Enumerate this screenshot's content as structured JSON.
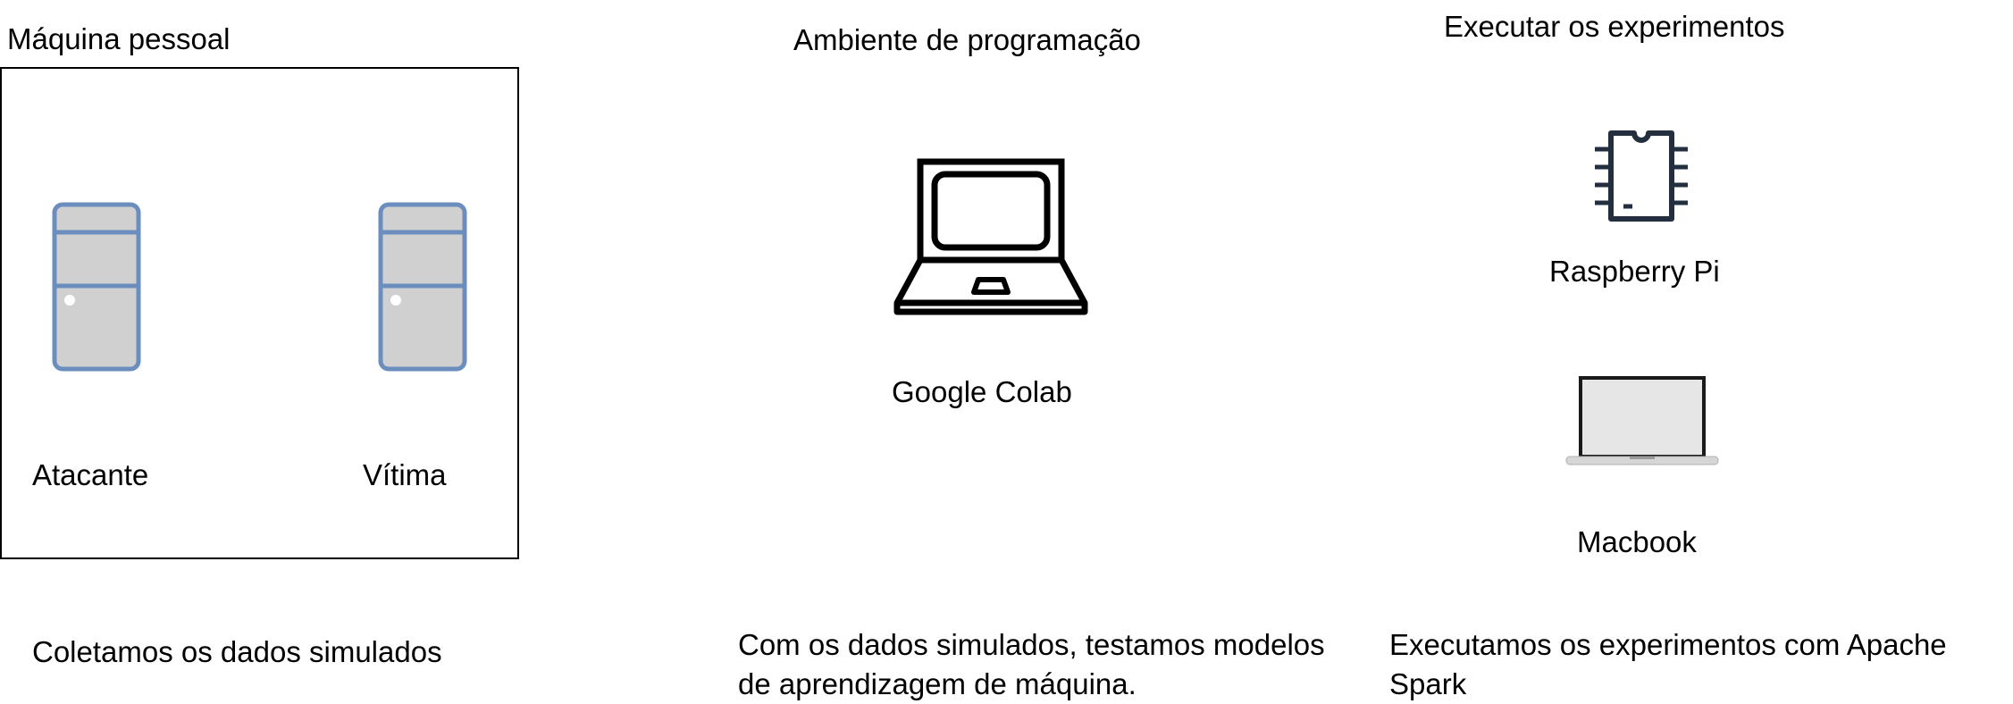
{
  "sections": {
    "personal_machine": {
      "title": "Máquina pessoal",
      "attacker_label": "Atacante",
      "victim_label": "Vítima",
      "caption": "Coletamos os dados simulados"
    },
    "programming_env": {
      "title": "Ambiente de programação",
      "platform_label": "Google Colab",
      "caption": "Com os dados simulados, testamos modelos de aprendizagem de máquina."
    },
    "experiments": {
      "title": "Executar os experimentos",
      "raspberry_label": "Raspberry Pi",
      "macbook_label": "Macbook",
      "caption": "Executamos os experimentos com Apache Spark"
    }
  },
  "colors": {
    "server_stroke": "#6c8ebf",
    "server_fill": "#d0d0d0",
    "chip_stroke": "#232f3e",
    "macbook_screen": "#e6e6e6"
  },
  "icons": [
    "server-icon",
    "laptop-icon",
    "chip-icon",
    "macbook-icon"
  ]
}
